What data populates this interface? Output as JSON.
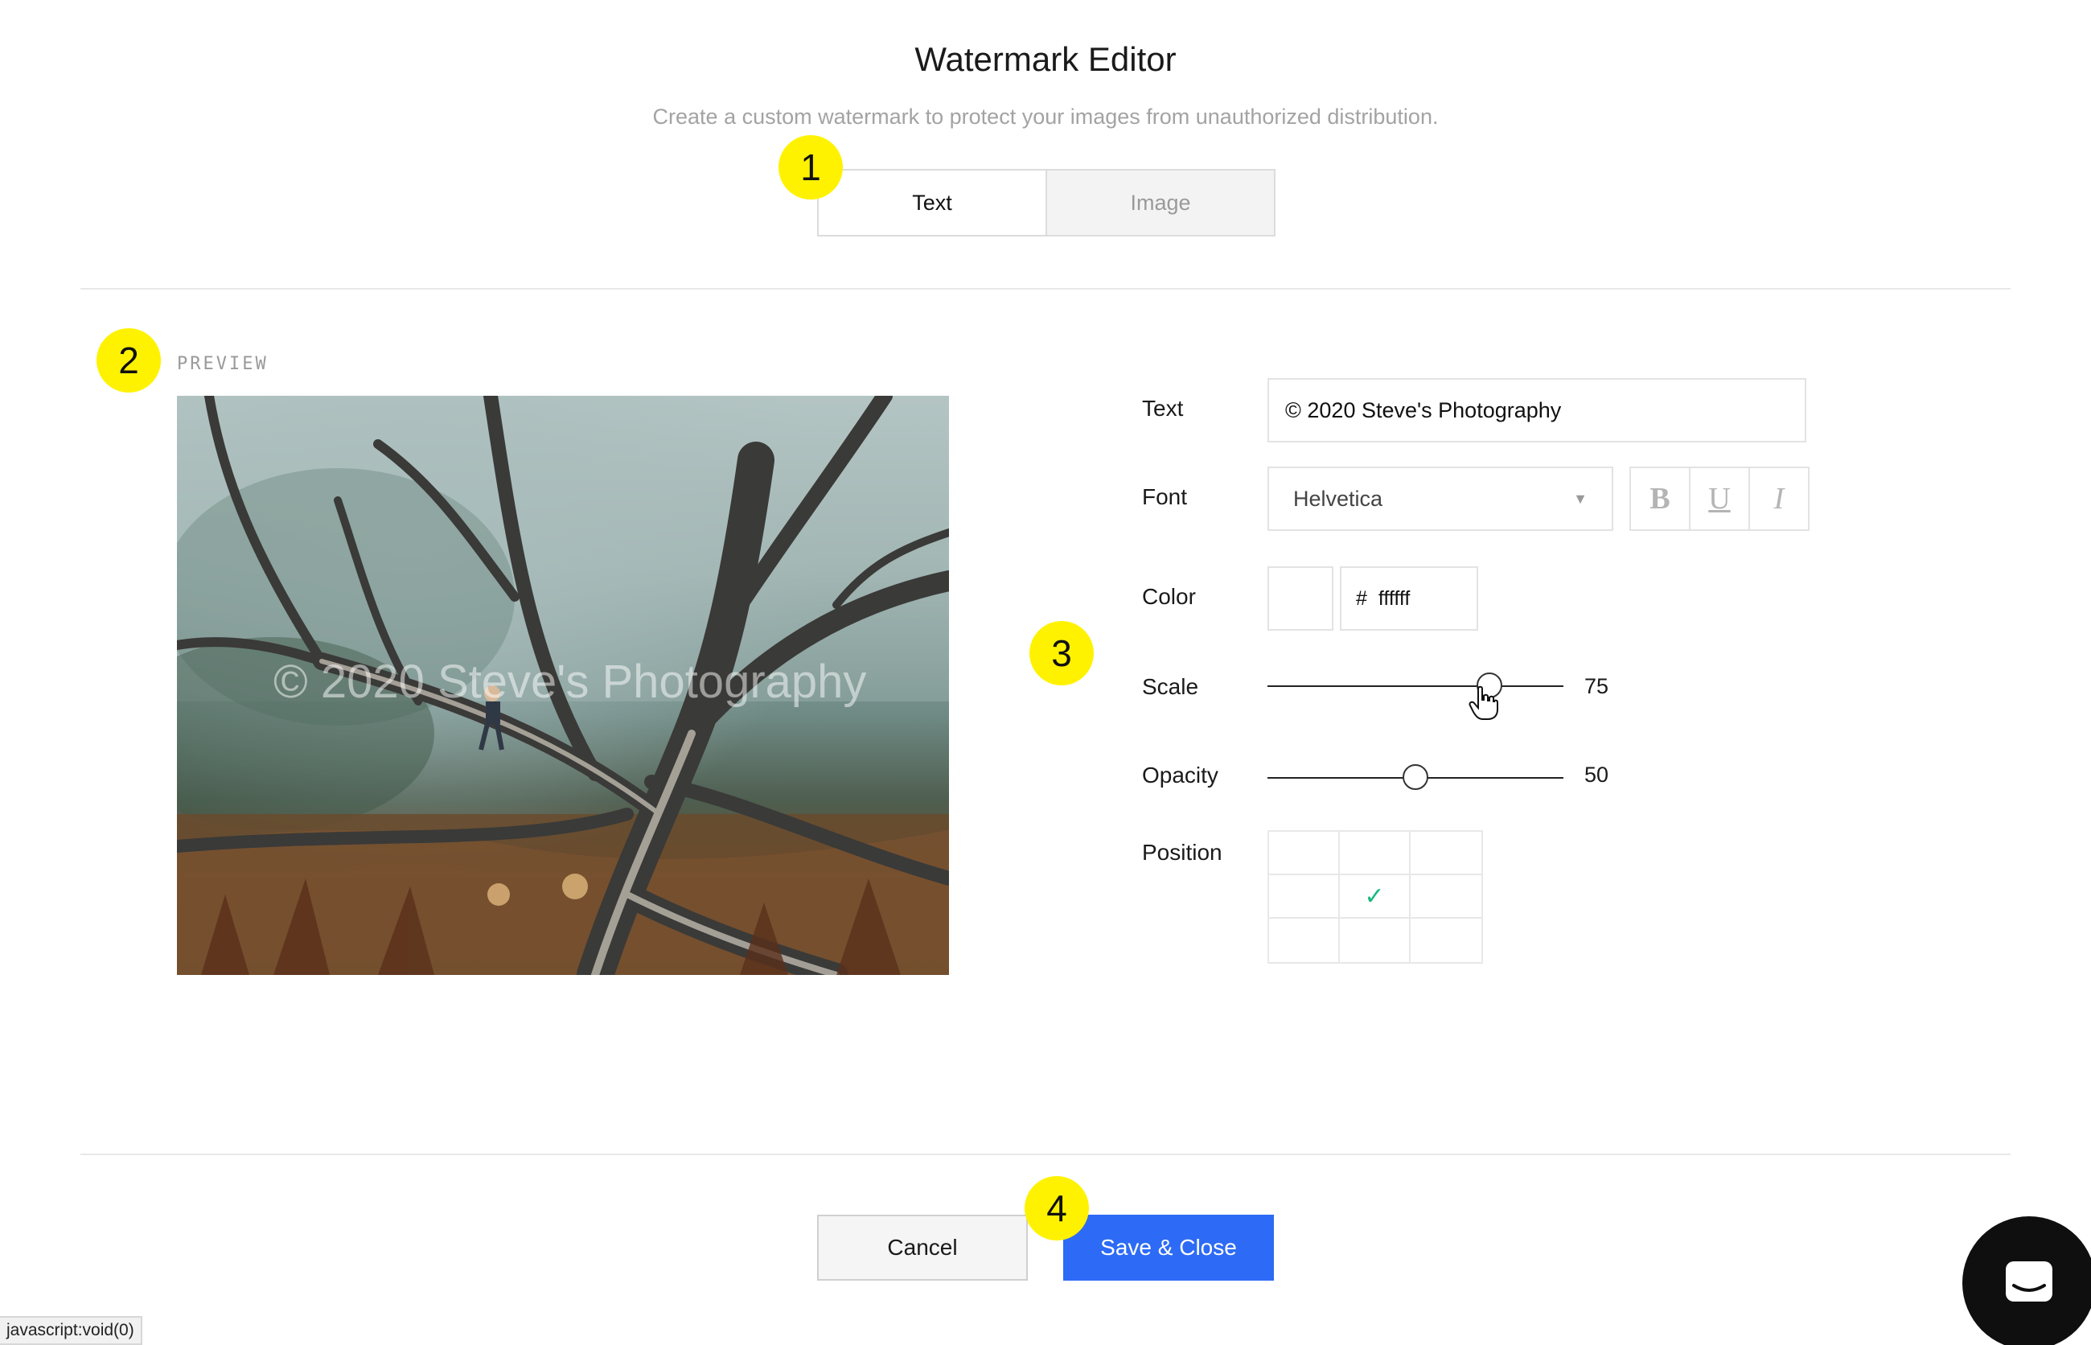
{
  "header": {
    "title": "Watermark Editor",
    "subtitle": "Create a custom watermark to protect your images from unauthorized distribution."
  },
  "tabs": [
    {
      "label": "Text",
      "active": true
    },
    {
      "label": "Image",
      "active": false
    }
  ],
  "badges": [
    "1",
    "2",
    "3",
    "4"
  ],
  "preview": {
    "label": "PREVIEW",
    "watermark_text": "© 2020 Steve's Photography"
  },
  "form": {
    "text": {
      "label": "Text",
      "value": "© 2020 Steve's Photography"
    },
    "font": {
      "label": "Font",
      "value": "Helvetica",
      "styles": [
        "B",
        "U",
        "I"
      ]
    },
    "color": {
      "label": "Color",
      "hash": "#",
      "value": "ffffff",
      "swatch": "#ffffff"
    },
    "scale": {
      "label": "Scale",
      "value": 75,
      "value_text": "75"
    },
    "opacity": {
      "label": "Opacity",
      "value": 50,
      "value_text": "50"
    },
    "position": {
      "label": "Position",
      "selected_index": 4,
      "check_glyph": "✓"
    }
  },
  "footer": {
    "cancel_label": "Cancel",
    "save_label": "Save & Close"
  },
  "status_bar": "javascript:void(0)",
  "colors": {
    "accent": "#2d6bf6",
    "badge": "#fff200",
    "check": "#19b97e"
  }
}
